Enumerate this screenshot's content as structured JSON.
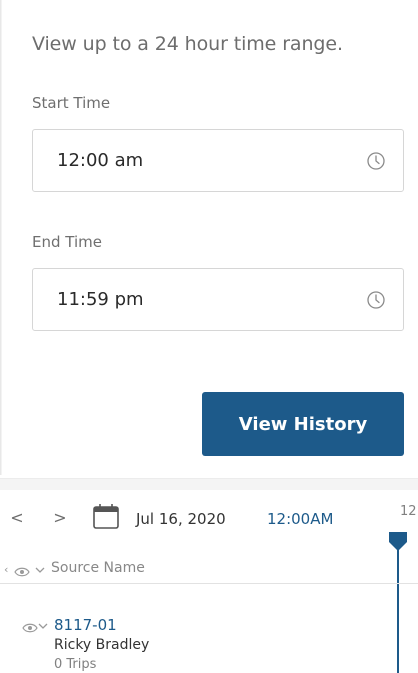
{
  "time_range": {
    "description": "View up to a 24 hour time range.",
    "start_label": "Start Time",
    "start_value": "12:00 am",
    "end_label": "End Time",
    "end_value": "11:59 pm",
    "view_history_label": "View History"
  },
  "timeline": {
    "prev_glyph": "<",
    "next_glyph": ">",
    "date": "Jul 16, 2020",
    "time": "12:00AM",
    "hour_tick": "12",
    "column_header": "Source Name",
    "rows": [
      {
        "source_id": "8117-01",
        "driver": "Ricky Bradley",
        "trips": "0 Trips"
      }
    ]
  },
  "colors": {
    "accent": "#1d5a8a",
    "text_muted": "#6d6d6d",
    "border": "#d6d6d6"
  },
  "icons": [
    "clock-icon",
    "calendar-icon",
    "eye-icon",
    "chevron-down-icon",
    "time-marker-icon"
  ]
}
